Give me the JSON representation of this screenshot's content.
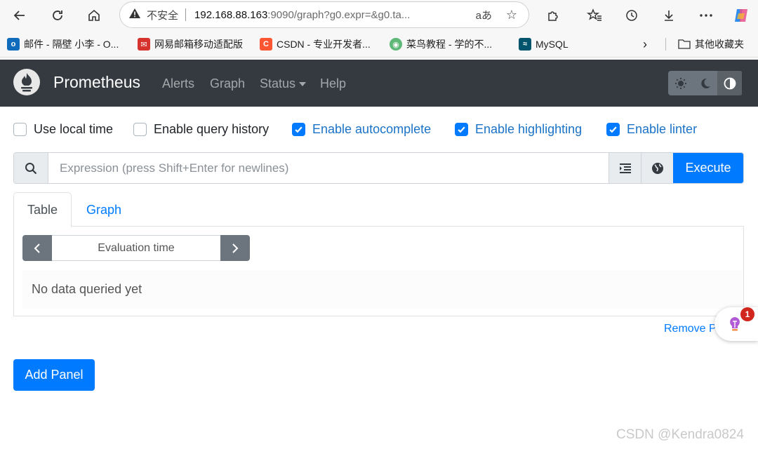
{
  "browser": {
    "insecure_label": "不安全",
    "url_host": "192.168.88.163",
    "url_path": ":9090/graph?g0.expr=&g0.ta...",
    "bookmarks": [
      {
        "label": "邮件 - 隔壁 小李 - O...",
        "color": "#0f6cbd",
        "glyph": "o"
      },
      {
        "label": "网易邮箱移动适配版",
        "color": "#d6322e",
        "glyph": "✉"
      },
      {
        "label": "CSDN - 专业开发者...",
        "color": "#fc5531",
        "glyph": "C"
      },
      {
        "label": "菜鸟教程 - 学的不...",
        "color": "#5fb878",
        "glyph": "◉"
      },
      {
        "label": "MySQL",
        "color": "#00546b",
        "glyph": "≈"
      }
    ],
    "other_bookmarks": "其他收藏夹"
  },
  "navbar": {
    "brand": "Prometheus",
    "links": [
      "Alerts",
      "Graph",
      "Status",
      "Help"
    ]
  },
  "options": [
    {
      "label": "Use local time",
      "checked": false
    },
    {
      "label": "Enable query history",
      "checked": false
    },
    {
      "label": "Enable autocomplete",
      "checked": true
    },
    {
      "label": "Enable highlighting",
      "checked": true
    },
    {
      "label": "Enable linter",
      "checked": true
    }
  ],
  "expression": {
    "placeholder": "Expression (press Shift+Enter for newlines)",
    "execute_label": "Execute"
  },
  "tabs": {
    "table": "Table",
    "graph": "Graph"
  },
  "evaluation": {
    "placeholder": "Evaluation time"
  },
  "result": {
    "empty": "No data queried yet"
  },
  "remove_panel_label": "Remove P",
  "notification_count": "1",
  "add_panel_label": "Add Panel",
  "watermark": "CSDN @Kendra0824",
  "colors": {
    "primary": "#007bff",
    "navbar": "#343a40",
    "secondary": "#6c757d"
  }
}
